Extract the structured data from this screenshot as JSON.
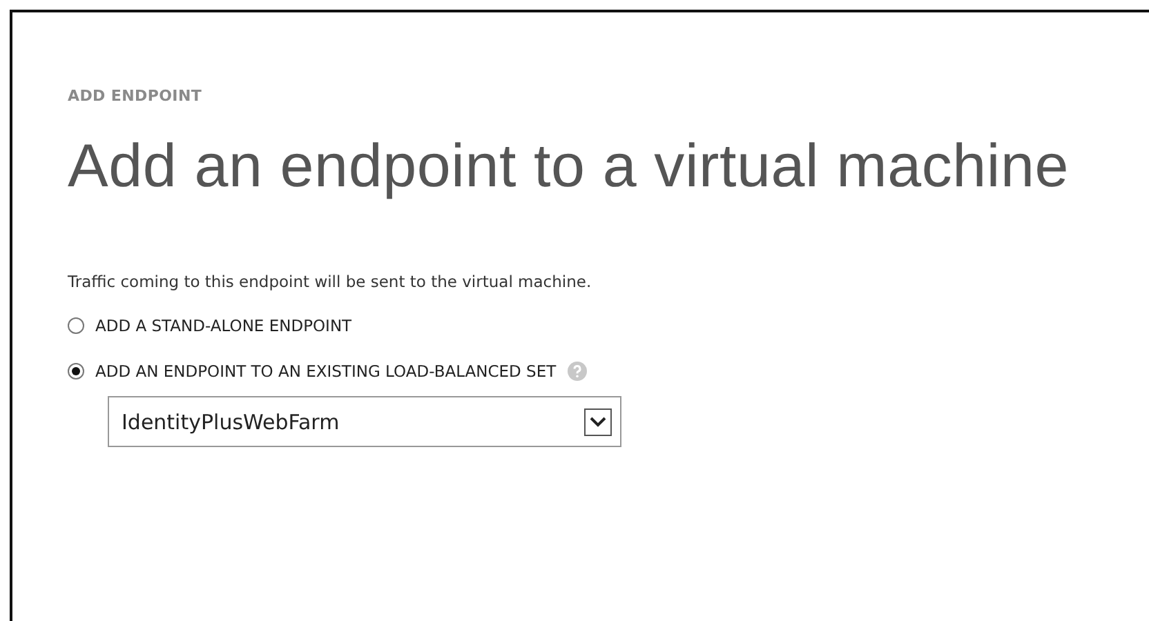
{
  "section_label": "ADD ENDPOINT",
  "title": "Add an endpoint to a virtual machine",
  "description": "Traffic coming to this endpoint will be sent to the virtual machine.",
  "options": [
    {
      "label": "ADD A STAND-ALONE ENDPOINT",
      "selected": false,
      "help": false
    },
    {
      "label": "ADD AN ENDPOINT TO AN EXISTING LOAD-BALANCED SET",
      "selected": true,
      "help": true
    }
  ],
  "dropdown": {
    "value": "IdentityPlusWebFarm"
  }
}
